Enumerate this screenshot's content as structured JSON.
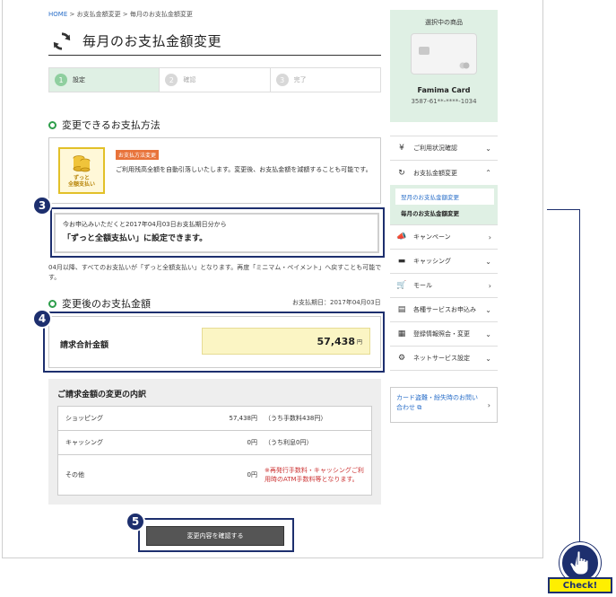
{
  "breadcrumb": {
    "home": "HOME",
    "sep1": " > ",
    "mid": "お支払金額変更",
    "sep2": " > ",
    "current": "毎月のお支払金額変更"
  },
  "page": {
    "title": "毎月のお支払金額変更"
  },
  "steps": [
    {
      "num": "1",
      "label": "設定"
    },
    {
      "num": "2",
      "label": "確認"
    },
    {
      "num": "3",
      "label": "完了"
    }
  ],
  "section1": {
    "title": "変更できるお支払方法",
    "icon_label": "ずっと\n全額支払い",
    "badge": "お支払方法変更",
    "description": "ご利用残高全額を自動引落しいたします。変更後、お支払金額を減額することも可能です。"
  },
  "notice": {
    "line1": "今お申込みいただくと2017年04月03日お支払期日分から",
    "line2": "「ずっと全額支払い」に設定できます。"
  },
  "note": "04月以降、すべてのお支払いが「ずっと全額支払い」となります。再度「ミニマム・ペイメント」へ戻すことも可能です。",
  "section2": {
    "title": "変更後のお支払金額",
    "due_date": "お支払期日：2017年04月03日",
    "total_label": "請求合計金額",
    "total_value": "57,438",
    "total_unit": "円"
  },
  "breakdown": {
    "title": "ご請求金額の変更の内訳",
    "rows": [
      {
        "name": "ショッピング",
        "amount": "57,438円",
        "detail": "（うち手数料438円）"
      },
      {
        "name": "キャッシング",
        "amount": "0円",
        "detail": "（うち利息0円）"
      },
      {
        "name": "その他",
        "amount": "0円",
        "detail": "※再発行手数料・キャッシングご利用時のATM手数料等となります。"
      }
    ]
  },
  "confirm_button": "変更内容を確認する",
  "markers": {
    "m3": "3",
    "m4": "4",
    "m5": "5"
  },
  "sidebar": {
    "card_panel_title": "選択中の商品",
    "card_name": "Famima Card",
    "card_number": "3587-61**-****-1034",
    "nav": [
      {
        "icon": "¥",
        "label": "ご利用状況確認",
        "chevron": "⌄"
      },
      {
        "icon": "↻",
        "label": "お支払金額変更",
        "chevron": "⌃"
      },
      {
        "icon": "📣",
        "label": "キャンペーン",
        "chevron": "›"
      },
      {
        "icon": "▬",
        "label": "キャッシング",
        "chevron": "⌄"
      },
      {
        "icon": "🛒",
        "label": "モール",
        "chevron": "›"
      },
      {
        "icon": "▤",
        "label": "各種サービスお申込み",
        "chevron": "⌄"
      },
      {
        "icon": "▦",
        "label": "登録情報照会・変更",
        "chevron": "⌄"
      },
      {
        "icon": "⚙",
        "label": "ネットサービス設定",
        "chevron": "⌄"
      }
    ],
    "sub_items": [
      {
        "label": "翌月のお支払金額変更"
      },
      {
        "label": "毎月のお支払金額変更"
      }
    ],
    "link_text": "カード盗難・紛失時のお問い合わせ",
    "link_icon": "⧉",
    "link_chevron": "›"
  },
  "check_label": "Check!",
  "colors": {
    "accent_green": "#2e9e4b",
    "navy": "#1d2f6e",
    "highlight_yellow": "#fbf5c4",
    "badge_orange": "#e8733a"
  }
}
